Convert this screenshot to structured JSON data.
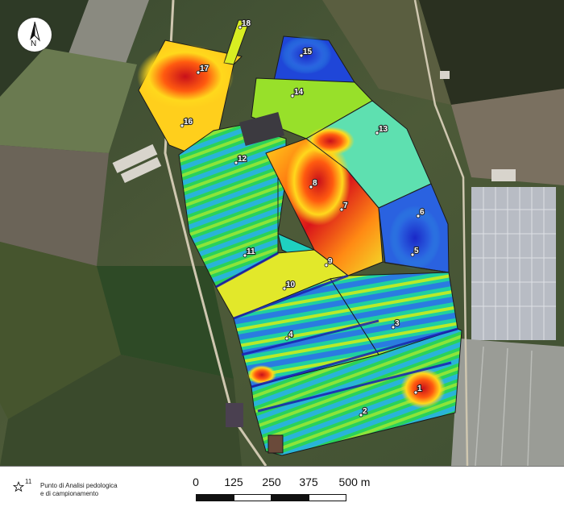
{
  "points": [
    {
      "id": "1"
    },
    {
      "id": "2"
    },
    {
      "id": "3"
    },
    {
      "id": "4"
    },
    {
      "id": "5"
    },
    {
      "id": "6"
    },
    {
      "id": "7"
    },
    {
      "id": "8"
    },
    {
      "id": "9"
    },
    {
      "id": "10"
    },
    {
      "id": "11"
    },
    {
      "id": "12"
    },
    {
      "id": "13"
    },
    {
      "id": "14"
    },
    {
      "id": "15"
    },
    {
      "id": "16"
    },
    {
      "id": "17"
    },
    {
      "id": "18"
    }
  ],
  "north_arrow": {
    "label": "N",
    "icon": "north-arrow-icon"
  },
  "legend": {
    "symbol_icon": "star-icon",
    "symbol_number": "11",
    "line1": "Punto di Analisi pedologica",
    "line2": "e di campionamento"
  },
  "scale": {
    "ticks": [
      "0",
      "125",
      "250",
      "375",
      "500 m"
    ],
    "segment_colors": [
      "#111111",
      "#ffffff",
      "#111111",
      "#ffffff",
      "#111111"
    ]
  },
  "colors": {
    "low": "#1e3cd8",
    "mid": "#22e06a",
    "high_mid": "#ffe21a",
    "high": "#e21612"
  }
}
